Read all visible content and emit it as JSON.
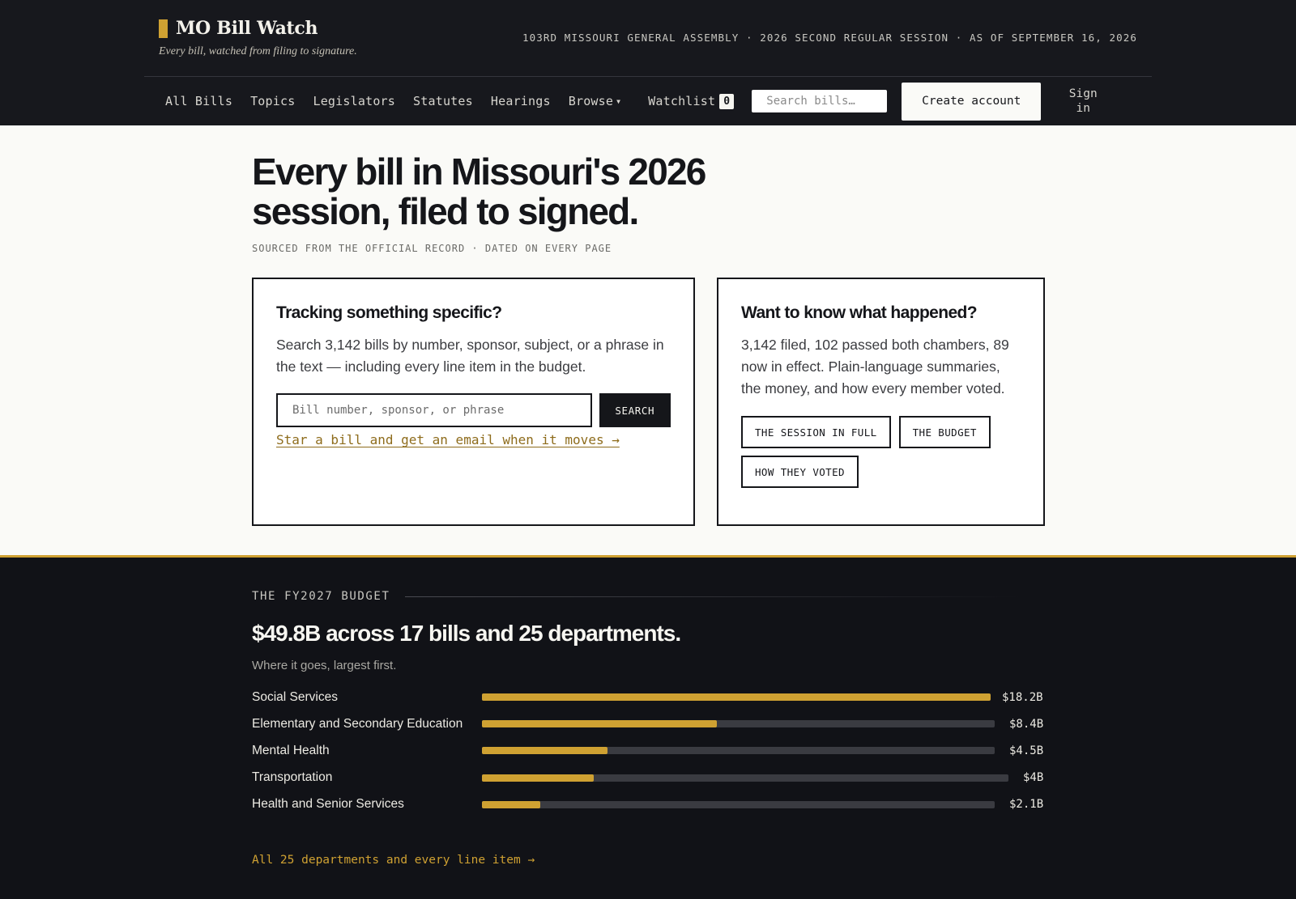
{
  "brand": {
    "name": "MO Bill Watch",
    "tagline": "Every bill, watched from filing to signature."
  },
  "session_line": "103RD MISSOURI GENERAL ASSEMBLY · 2026 SECOND REGULAR SESSION · AS OF SEPTEMBER 16, 2026",
  "nav": {
    "items": [
      "All Bills",
      "Topics",
      "Legislators",
      "Statutes",
      "Hearings"
    ],
    "browse": "Browse",
    "watchlist": "Watchlist",
    "watchlist_count": "0",
    "search_placeholder": "Search bills…",
    "create_account": "Create account",
    "sign_in": "Sign in"
  },
  "hero": {
    "headline": "Every bill in Missouri's 2026 session, filed to signed.",
    "sourced": "SOURCED FROM THE OFFICIAL RECORD · DATED ON EVERY PAGE"
  },
  "card_track": {
    "title": "Tracking something specific?",
    "body": "Search 3,142 bills by number, sponsor, subject, or a phrase in the text — including every line item in the budget.",
    "placeholder": "Bill number, sponsor, or phrase",
    "button": "SEARCH",
    "link": "Star a bill and get an email when it moves →"
  },
  "card_happened": {
    "title": "Want to know what happened?",
    "body": "3,142 filed, 102 passed both chambers, 89 now in effect. Plain-language summaries, the money, and how every member voted.",
    "chips": [
      "THE SESSION IN FULL",
      "THE BUDGET",
      "HOW THEY VOTED"
    ]
  },
  "budget": {
    "eyebrow": "THE FY2027 BUDGET",
    "title": "$49.8B across 17 bills and 25 departments.",
    "subtitle": "Where it goes, largest first.",
    "link": "All 25 departments and every line item →"
  },
  "chart_data": {
    "type": "bar",
    "orientation": "horizontal",
    "categories": [
      "Social Services",
      "Elementary and Secondary Education",
      "Mental Health",
      "Transportation",
      "Health and Senior Services"
    ],
    "values": [
      18.2,
      8.4,
      4.5,
      4,
      2.1
    ],
    "value_labels": [
      "$18.2B",
      "$8.4B",
      "$4.5B",
      "$4B",
      "$2.1B"
    ],
    "max": 18.2,
    "colors": {
      "fill": "#cfa132",
      "track": "#3a3b41"
    }
  }
}
